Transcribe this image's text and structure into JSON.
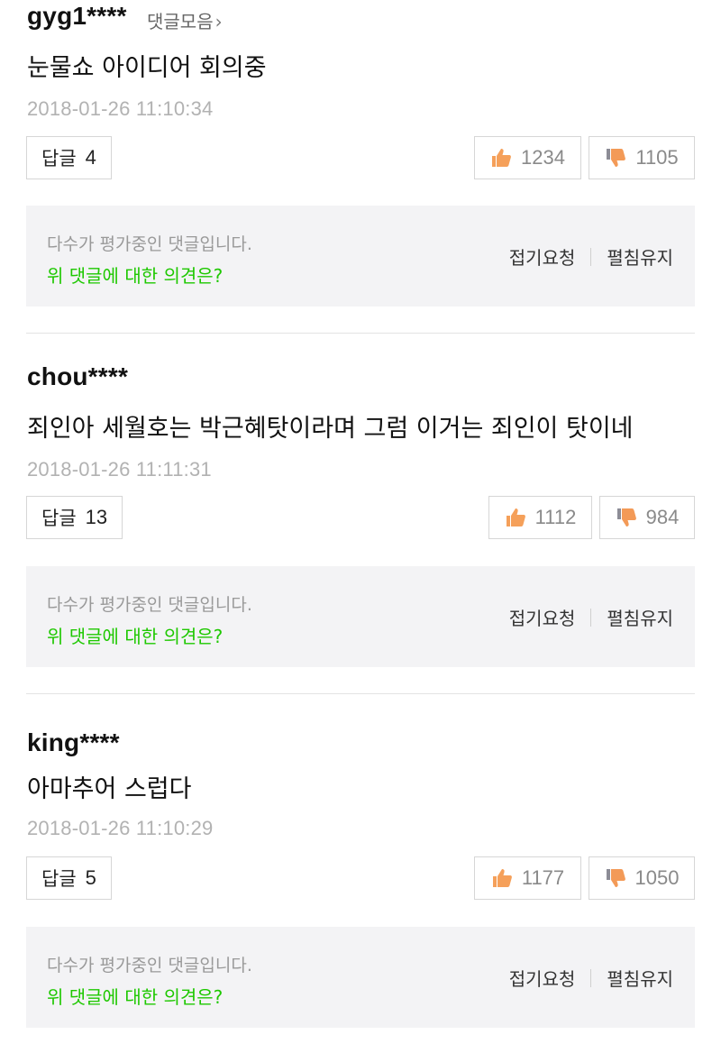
{
  "comments": [
    {
      "username": "gyg1****",
      "more_link": "댓글모음",
      "text": "눈물쇼 아이디어 회의중",
      "date": "2018-01-26 11:10:34",
      "reply_label": "답글",
      "reply_count": "4",
      "likes": "1234",
      "dislikes": "1105"
    },
    {
      "username": "chou****",
      "text": "죄인아 세월호는 박근혜탓이라며 그럼 이거는 죄인이 탓이네",
      "date": "2018-01-26 11:11:31",
      "reply_label": "답글",
      "reply_count": "13",
      "likes": "1112",
      "dislikes": "984"
    },
    {
      "username": "king****",
      "text": "아마추어 스럽다",
      "date": "2018-01-26 11:10:29",
      "reply_label": "답글",
      "reply_count": "5",
      "likes": "1177",
      "dislikes": "1050"
    }
  ],
  "eval_box": {
    "message": "다수가 평가중인 댓글입니다.",
    "question": "위 댓글에 대한 의견은?",
    "fold_request": "접기요청",
    "keep_open": "펼침유지"
  },
  "icons": {
    "like": "thumbs-up-icon",
    "dislike": "thumbs-down-icon",
    "chevron": "chevron-right-icon"
  },
  "colors": {
    "accent_green": "#1ec800",
    "thumb_up": "#f5a05a",
    "thumb_down": "#f39a57",
    "muted_text": "#b2b2b2"
  }
}
